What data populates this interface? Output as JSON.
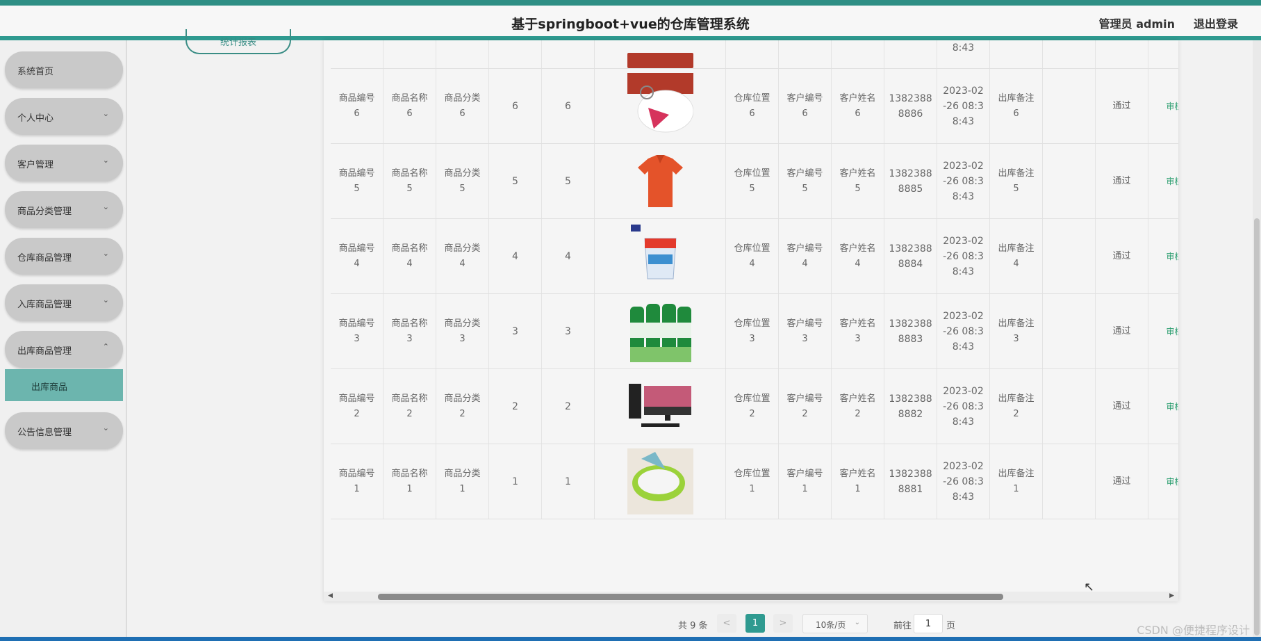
{
  "header": {
    "title": "基于springboot+vue的仓库管理系统",
    "user": "管理员 admin",
    "logout": "退出登录"
  },
  "sidebar": {
    "items": [
      {
        "label": "系统首页",
        "chevron": ""
      },
      {
        "label": "个人中心",
        "chevron": "⌄"
      },
      {
        "label": "客户管理",
        "chevron": "⌄"
      },
      {
        "label": "商品分类管理",
        "chevron": "⌄"
      },
      {
        "label": "仓库商品管理",
        "chevron": "⌄"
      },
      {
        "label": "入库商品管理",
        "chevron": "⌄"
      },
      {
        "label": "出库商品管理",
        "chevron": "⌃"
      },
      {
        "label": "公告信息管理",
        "chevron": "⌄"
      }
    ],
    "active_sub": "出库商品"
  },
  "stats_button": "统计报表",
  "table": {
    "top_partial": {
      "time": "8:43"
    },
    "rows": [
      {
        "code": [
          "商品编号",
          "6"
        ],
        "name": [
          "商品名称",
          "6"
        ],
        "cat": [
          "商品分类",
          "6"
        ],
        "a": "6",
        "b": "6",
        "img": "keychain",
        "loc": [
          "仓库位置",
          "6"
        ],
        "cust": [
          "客户编号",
          "6"
        ],
        "cname": [
          "客户姓名",
          "6"
        ],
        "phone": [
          "1382388",
          "8886"
        ],
        "time": [
          "2023-02",
          "-26 08:3",
          "8:43"
        ],
        "note": [
          "出库备注",
          "6"
        ],
        "status": "通过",
        "audit": "审核"
      },
      {
        "code": [
          "商品编号",
          "5"
        ],
        "name": [
          "商品名称",
          "5"
        ],
        "cat": [
          "商品分类",
          "5"
        ],
        "a": "5",
        "b": "5",
        "img": "shirt",
        "loc": [
          "仓库位置",
          "5"
        ],
        "cust": [
          "客户编号",
          "5"
        ],
        "cname": [
          "客户姓名",
          "5"
        ],
        "phone": [
          "1382388",
          "8885"
        ],
        "time": [
          "2023-02",
          "-26 08:3",
          "8:43"
        ],
        "note": [
          "出库备注",
          "5"
        ],
        "status": "通过",
        "audit": "审核"
      },
      {
        "code": [
          "商品编号",
          "4"
        ],
        "name": [
          "商品名称",
          "4"
        ],
        "cat": [
          "商品分类",
          "4"
        ],
        "a": "4",
        "b": "4",
        "img": "paint-bucket",
        "loc": [
          "仓库位置",
          "4"
        ],
        "cust": [
          "客户编号",
          "4"
        ],
        "cname": [
          "客户姓名",
          "4"
        ],
        "phone": [
          "1382388",
          "8884"
        ],
        "time": [
          "2023-02",
          "-26 08:3",
          "8:43"
        ],
        "note": [
          "出库备注",
          "4"
        ],
        "status": "通过",
        "audit": "审核"
      },
      {
        "code": [
          "商品编号",
          "3"
        ],
        "name": [
          "商品名称",
          "3"
        ],
        "cat": [
          "商品分类",
          "3"
        ],
        "a": "3",
        "b": "3",
        "img": "drink-bottles",
        "loc": [
          "仓库位置",
          "3"
        ],
        "cust": [
          "客户编号",
          "3"
        ],
        "cname": [
          "客户姓名",
          "3"
        ],
        "phone": [
          "1382388",
          "8883"
        ],
        "time": [
          "2023-02",
          "-26 08:3",
          "8:43"
        ],
        "note": [
          "出库备注",
          "3"
        ],
        "status": "通过",
        "audit": "审核"
      },
      {
        "code": [
          "商品编号",
          "2"
        ],
        "name": [
          "商品名称",
          "2"
        ],
        "cat": [
          "商品分类",
          "2"
        ],
        "a": "2",
        "b": "2",
        "img": "computer",
        "loc": [
          "仓库位置",
          "2"
        ],
        "cust": [
          "客户编号",
          "2"
        ],
        "cname": [
          "客户姓名",
          "2"
        ],
        "phone": [
          "1382388",
          "8882"
        ],
        "time": [
          "2023-02",
          "-26 08:3",
          "8:43"
        ],
        "note": [
          "出库备注",
          "2"
        ],
        "status": "通过",
        "audit": "审核"
      },
      {
        "code": [
          "商品编号",
          "1"
        ],
        "name": [
          "商品名称",
          "1"
        ],
        "cat": [
          "商品分类",
          "1"
        ],
        "a": "1",
        "b": "1",
        "img": "green-basin",
        "loc": [
          "仓库位置",
          "1"
        ],
        "cust": [
          "客户编号",
          "1"
        ],
        "cname": [
          "客户姓名",
          "1"
        ],
        "phone": [
          "1382388",
          "8881"
        ],
        "time": [
          "2023-02",
          "-26 08:3",
          "8:43"
        ],
        "note": [
          "出库备注",
          "1"
        ],
        "status": "通过",
        "audit": "审核"
      }
    ]
  },
  "pagination": {
    "total": "共 9 条",
    "prev": "<",
    "current": "1",
    "next": ">",
    "page_size": "10条/页",
    "goto_label": "前往",
    "goto_value": "1",
    "page_unit": "页"
  },
  "watermark": "CSDN @便捷程序设计",
  "colors": {
    "accent": "#2f9a90",
    "active_sub": "#6cb5ae",
    "audit": "#2a9d6e"
  }
}
